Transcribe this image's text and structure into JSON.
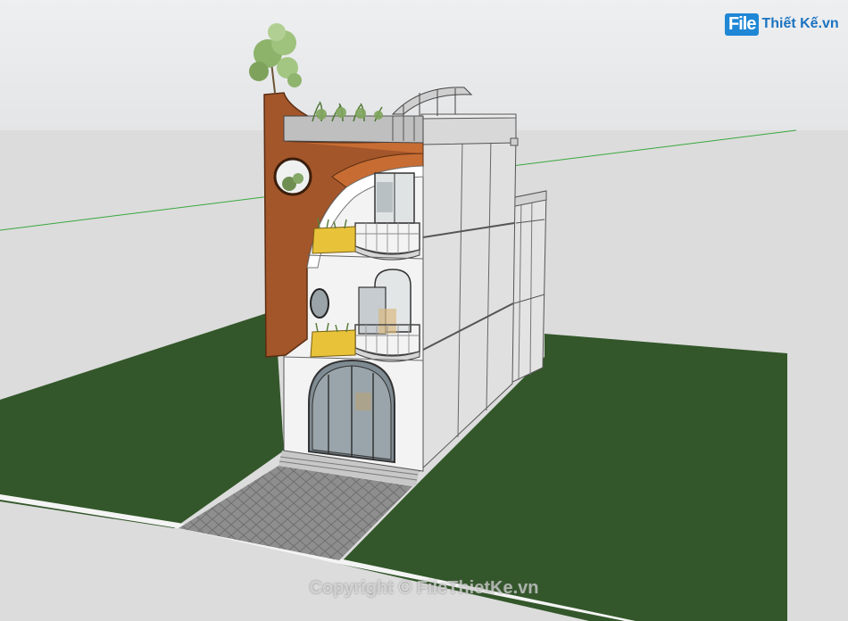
{
  "watermark": {
    "logo_box": "File",
    "logo_text": "Thiết Kế.vn",
    "copyright": "Copyright © FileThietKe.vn"
  },
  "colors": {
    "sky": "#e9eaec",
    "ground": "#dcdcdc",
    "lawn": "#33572a",
    "walls": "#f1f1f1",
    "side_wall": "#dedede",
    "accent_panel": "#a3562a",
    "planters": "#e8c33a",
    "path": "#8a8a8a",
    "axis_line": "#39a73c"
  },
  "icons": [
    "tree-icon",
    "plant-icon"
  ]
}
